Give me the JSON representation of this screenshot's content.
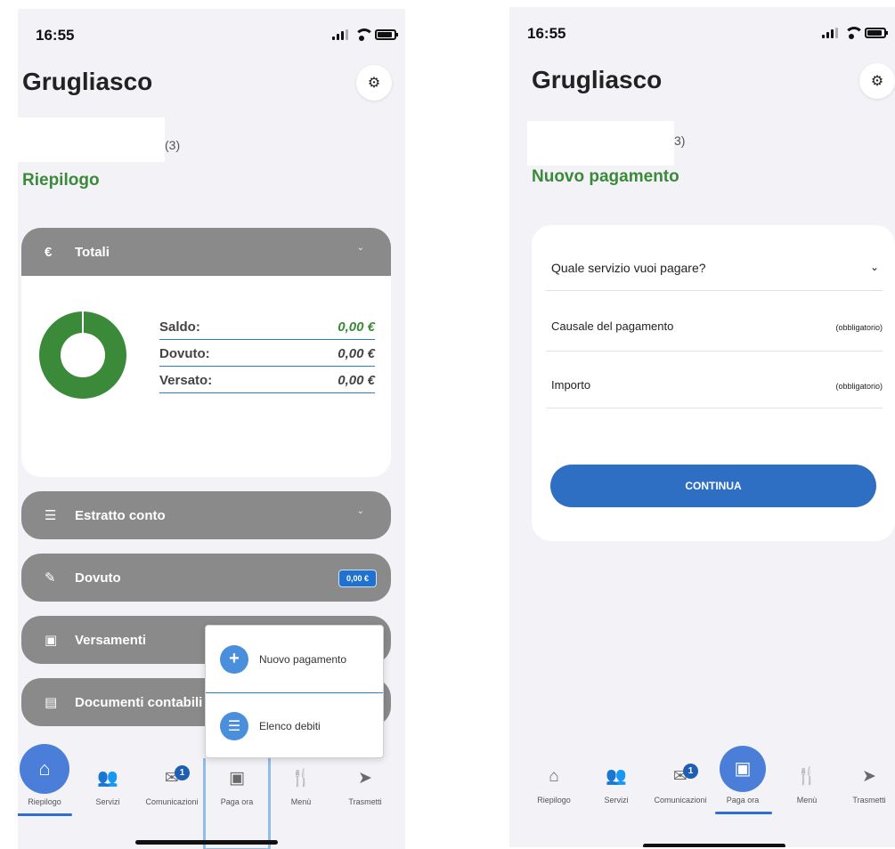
{
  "status": {
    "time": "16:55"
  },
  "header": {
    "city": "Grugliasco",
    "user_suffix_left": "(3)",
    "user_suffix_right": "3)"
  },
  "left": {
    "section_title": "Riepilogo",
    "cards": {
      "totali": {
        "label": "Totali",
        "icon": "€"
      },
      "estratto": {
        "label": "Estratto conto"
      },
      "dovuto": {
        "label": "Dovuto",
        "badge": "0,00 €"
      },
      "versamenti": {
        "label": "Versamenti"
      },
      "documenti": {
        "label": "Documenti contabili"
      }
    },
    "totals": [
      {
        "label": "Saldo:",
        "value": "0,00 €",
        "color": "#3a8a3a"
      },
      {
        "label": "Dovuto:",
        "value": "0,00 €",
        "color": "#444444"
      },
      {
        "label": "Versato:",
        "value": "0,00 €",
        "color": "#444444"
      }
    ],
    "popup": {
      "new_payment": "Nuovo pagamento",
      "debt_list": "Elenco debiti"
    }
  },
  "right": {
    "section_title": "Nuovo pagamento",
    "service_select": "Quale servizio vuoi pagare?",
    "causale": {
      "label": "Causale del pagamento",
      "hint": "(obbligatorio)"
    },
    "importo": {
      "label": "Importo",
      "hint": "(obbligatorio)"
    },
    "continue": "CONTINUA"
  },
  "tabs": {
    "riepilogo": "Riepilogo",
    "servizi": "Servizi",
    "comunicazioni": "Comunicazioni",
    "comunicazioni_badge": "1",
    "paga_ora": "Paga ora",
    "menu": "Menù",
    "trasmetti": "Trasmetti"
  },
  "colors": {
    "accent_green": "#3a8a3a",
    "primary_blue": "#2e6fc4",
    "card_gray": "#8a8a8a"
  }
}
